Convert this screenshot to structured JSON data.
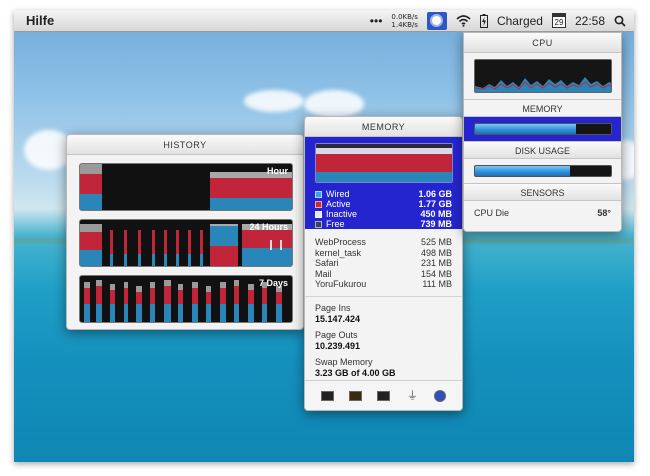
{
  "menubar": {
    "app_name": "Hilfe",
    "dots": "•••",
    "net_up": "0.0KB/s",
    "net_down": "1.4KB/s",
    "battery_label": "Charged",
    "calendar_day": "29",
    "time": "22:58"
  },
  "history": {
    "title": "HISTORY",
    "graphs": [
      {
        "label": "Hour"
      },
      {
        "label": "24 Hours"
      },
      {
        "label": "7 Days"
      }
    ]
  },
  "memory": {
    "title": "MEMORY",
    "legend": [
      {
        "name": "Wired",
        "value": "1.06 GB",
        "color": "#3aa0e8"
      },
      {
        "name": "Active",
        "value": "1.77 GB",
        "color": "#d0263a"
      },
      {
        "name": "Inactive",
        "value": "450 MB",
        "color": "#e9e9f4"
      },
      {
        "name": "Free",
        "value": "739 MB",
        "color": "#3f3f56"
      }
    ],
    "processes": [
      {
        "name": "WebProcess",
        "value": "525 MB"
      },
      {
        "name": "kernel_task",
        "value": "498 MB"
      },
      {
        "name": "Safari",
        "value": "231 MB"
      },
      {
        "name": "Mail",
        "value": "154 MB"
      },
      {
        "name": "YoruFukurou",
        "value": "111 MB"
      }
    ],
    "page_ins_label": "Page Ins",
    "page_ins_value": "15.147.424",
    "page_outs_label": "Page Outs",
    "page_outs_value": "10.239.491",
    "swap_label": "Swap Memory",
    "swap_value": "3.23 GB of 4.00 GB"
  },
  "stats": {
    "cpu_title": "CPU",
    "memory_title": "MEMORY",
    "memory_usage_fraction": 0.74,
    "disk_title": "DISK USAGE",
    "disk_usage_fraction": 0.7,
    "sensors_title": "SENSORS",
    "sensor_name": "CPU Die",
    "sensor_value": "58°"
  }
}
